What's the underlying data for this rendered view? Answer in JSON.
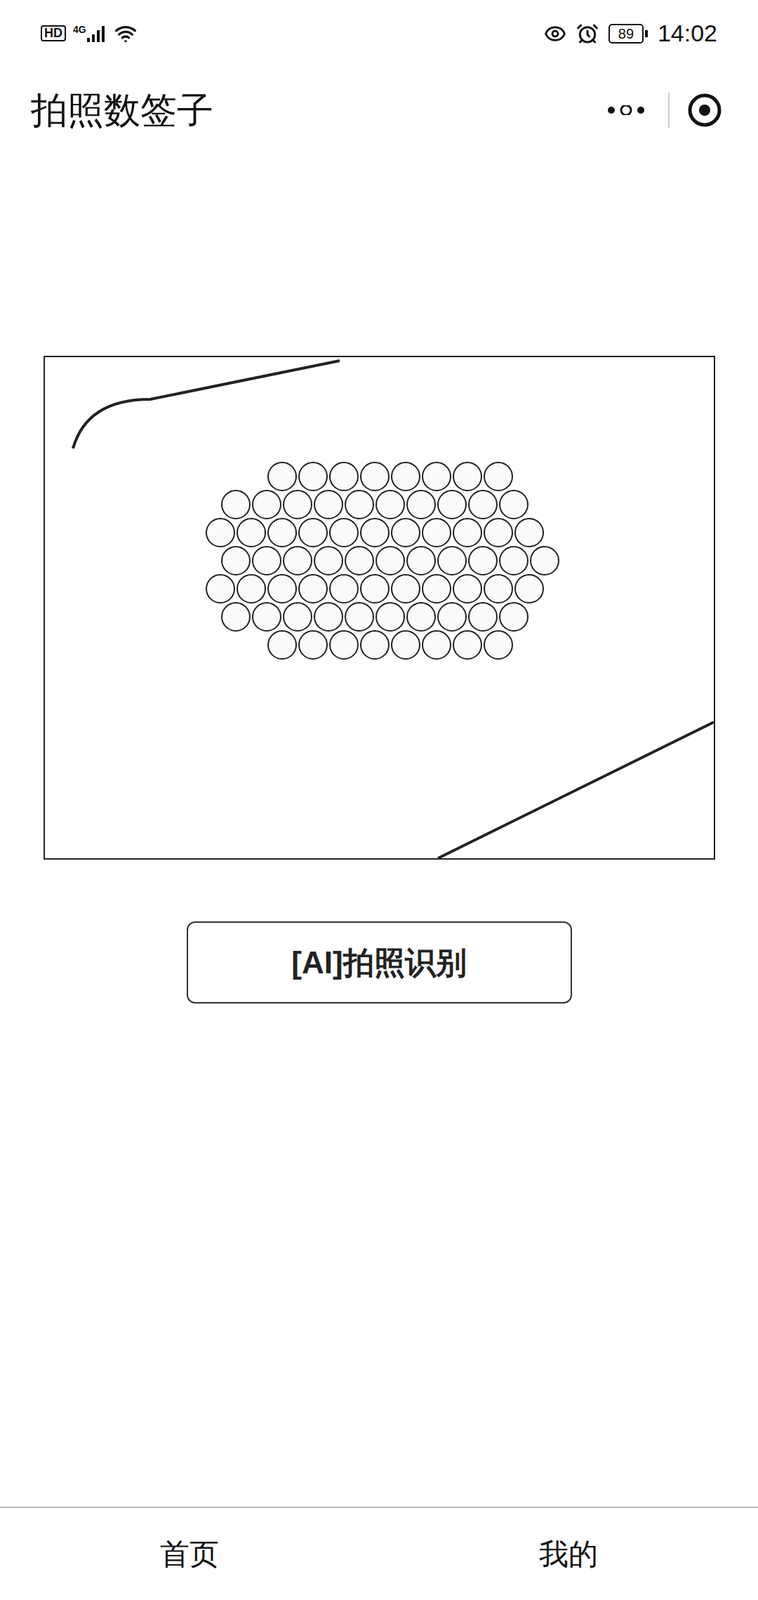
{
  "window": {
    "title": "拍照数签子"
  },
  "status_bar": {
    "hd": "HD",
    "network": "4G",
    "battery": "89",
    "time": "14:02"
  },
  "button": {
    "label": "[AI]拍照识别"
  },
  "tab_bar": [
    {
      "label": "首页"
    },
    {
      "label": "我的"
    }
  ]
}
